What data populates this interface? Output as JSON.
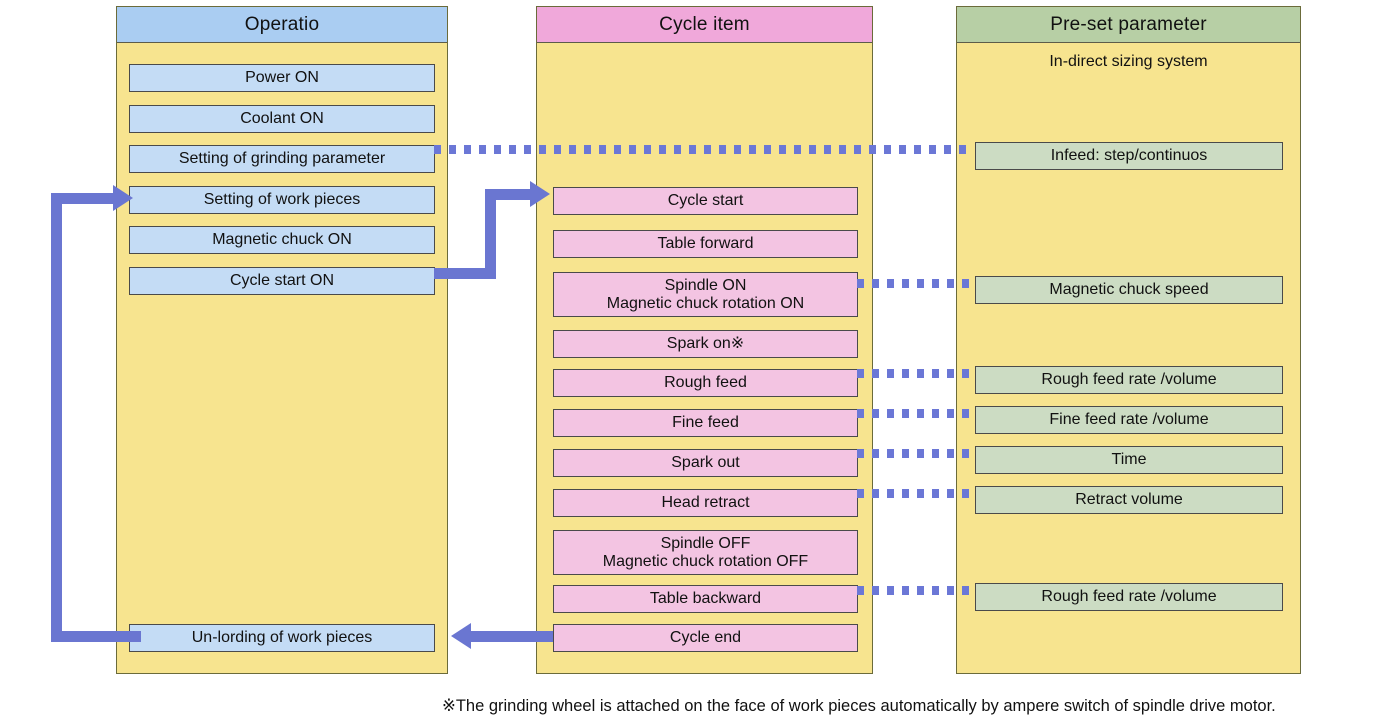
{
  "columns": {
    "operation": {
      "title": "Operatio",
      "items": [
        {
          "label": "Power ON"
        },
        {
          "label": "Coolant ON"
        },
        {
          "label": "Setting of grinding parameter"
        },
        {
          "label": "Setting of work pieces"
        },
        {
          "label": "Magnetic chuck ON"
        },
        {
          "label": "Cycle start ON"
        },
        {
          "label": "Un-lording of work pieces"
        }
      ]
    },
    "cycle": {
      "title": "Cycle item",
      "items": [
        {
          "label": "Cycle start"
        },
        {
          "label": "Table forward"
        },
        {
          "label": "Spindle ON\nMagnetic chuck rotation ON"
        },
        {
          "label": "Spark on※"
        },
        {
          "label": "Rough feed"
        },
        {
          "label": "Fine feed"
        },
        {
          "label": "Spark out"
        },
        {
          "label": "Head retract"
        },
        {
          "label": "Spindle OFF\nMagnetic chuck rotation OFF"
        },
        {
          "label": "Table backward"
        },
        {
          "label": "Cycle end"
        }
      ]
    },
    "preset": {
      "title": "Pre-set parameter",
      "subtitle": "In-direct sizing system",
      "items": [
        {
          "label": "Infeed: step/continuos"
        },
        {
          "label": "Magnetic chuck speed"
        },
        {
          "label": "Rough feed rate /volume"
        },
        {
          "label": "Fine feed rate /volume"
        },
        {
          "label": "Time"
        },
        {
          "label": "Retract volume"
        },
        {
          "label": "Rough feed rate /volume"
        }
      ]
    }
  },
  "caption": "※The grinding wheel is attached on the face of work pieces automatically by ampere switch of spindle drive motor.",
  "colors": {
    "operation_header": "#aacdf2",
    "cycle_header": "#f0a8da",
    "preset_header": "#b7cfa5",
    "column_body": "#f7e48f",
    "operation_item": "#c4dcf5",
    "cycle_item": "#f3c4e2",
    "preset_item": "#ccdcc3",
    "connector": "#6a76d1"
  }
}
